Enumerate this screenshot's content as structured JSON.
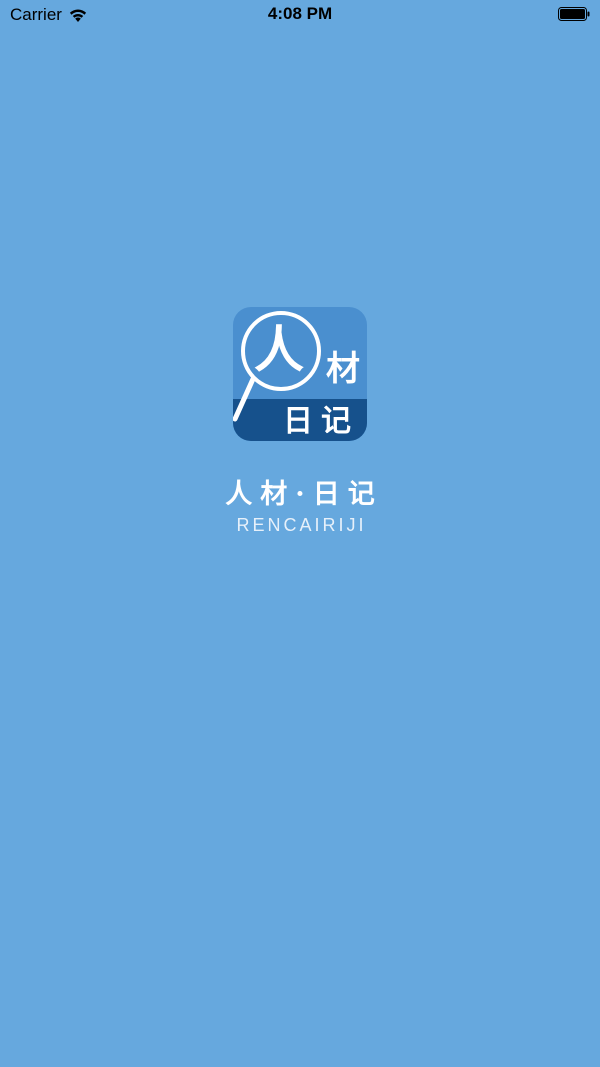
{
  "status_bar": {
    "carrier": "Carrier",
    "time": "4:08 PM",
    "wifi_icon": "wifi-icon",
    "battery_icon": "battery-icon"
  },
  "splash": {
    "background_color": "#66a8de",
    "logo": {
      "char_1": "人",
      "char_2": "材",
      "char_3": "日",
      "char_4": "记",
      "top_color": "#4a8fcf",
      "bottom_color": "#16518c"
    },
    "brand_cn": "人材·日记",
    "brand_en": "RENCAIRIJI"
  }
}
